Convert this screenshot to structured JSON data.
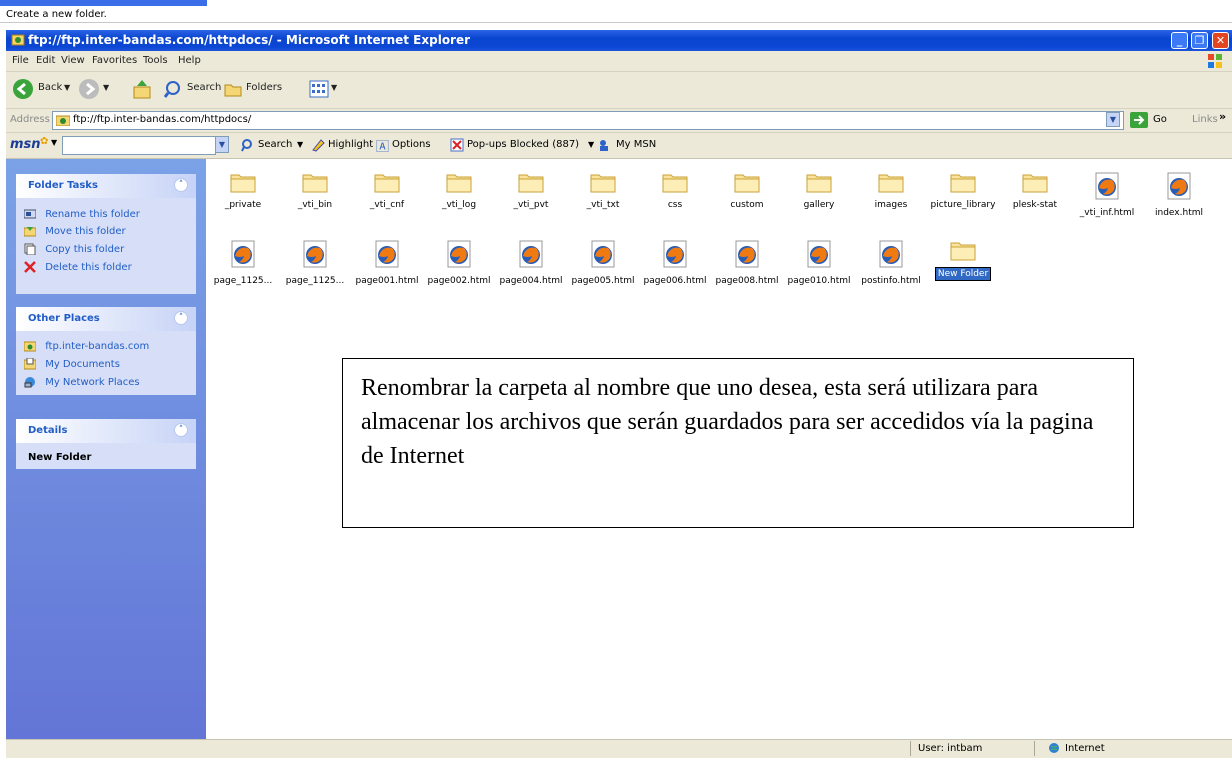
{
  "tooltip_text": "Create a new folder.",
  "window": {
    "title": "ftp://ftp.inter-bandas.com/httpdocs/ - Microsoft Internet Explorer"
  },
  "menu": [
    "File",
    "Edit",
    "View",
    "Favorites",
    "Tools",
    "Help"
  ],
  "toolbar": {
    "back": "Back",
    "search": "Search",
    "folders": "Folders"
  },
  "address": {
    "label": "Address",
    "value": "ftp://ftp.inter-bandas.com/httpdocs/",
    "go": "Go",
    "links": "Links"
  },
  "msn": {
    "logo": "msn",
    "search": "Search",
    "highlight": "Highlight",
    "options": "Options",
    "popups": "Pop-ups Blocked (887)",
    "my_msn": "My MSN"
  },
  "sidebar": {
    "folder_tasks": {
      "title": "Folder Tasks",
      "items": [
        "Rename this folder",
        "Move this folder",
        "Copy this folder",
        "Delete this folder"
      ]
    },
    "other_places": {
      "title": "Other Places",
      "items": [
        "ftp.inter-bandas.com",
        "My Documents",
        "My Network Places"
      ]
    },
    "details": {
      "title": "Details",
      "name": "New Folder"
    }
  },
  "files_row1": [
    {
      "name": "_private",
      "type": "folder"
    },
    {
      "name": "_vti_bin",
      "type": "folder"
    },
    {
      "name": "_vti_cnf",
      "type": "folder"
    },
    {
      "name": "_vti_log",
      "type": "folder"
    },
    {
      "name": "_vti_pvt",
      "type": "folder"
    },
    {
      "name": "_vti_txt",
      "type": "folder"
    },
    {
      "name": "css",
      "type": "folder"
    },
    {
      "name": "custom",
      "type": "folder"
    },
    {
      "name": "gallery",
      "type": "folder"
    },
    {
      "name": "images",
      "type": "folder"
    },
    {
      "name": "picture_library",
      "type": "folder"
    },
    {
      "name": "plesk-stat",
      "type": "folder"
    },
    {
      "name": "_vti_inf.html",
      "type": "html"
    },
    {
      "name": "index.html",
      "type": "html"
    }
  ],
  "files_row2": [
    {
      "name": "page_1125...",
      "type": "html"
    },
    {
      "name": "page_1125...",
      "type": "html"
    },
    {
      "name": "page001.html",
      "type": "html"
    },
    {
      "name": "page002.html",
      "type": "html"
    },
    {
      "name": "page004.html",
      "type": "html"
    },
    {
      "name": "page005.html",
      "type": "html"
    },
    {
      "name": "page006.html",
      "type": "html"
    },
    {
      "name": "page008.html",
      "type": "html"
    },
    {
      "name": "page010.html",
      "type": "html"
    },
    {
      "name": "postinfo.html",
      "type": "html"
    },
    {
      "name": "New Folder",
      "type": "folder",
      "selected": true
    }
  ],
  "note_text": "Renombrar la carpeta al nombre que uno desea, esta será utilizara para almacenar los archivos que serán guardados para ser accedidos vía la pagina de Internet",
  "status": {
    "user": "User: intbam",
    "zone": "Internet"
  },
  "colors": {
    "title_bar": "#0a45cf",
    "sidebar": "#6f8be0",
    "selection": "#316ac5"
  }
}
